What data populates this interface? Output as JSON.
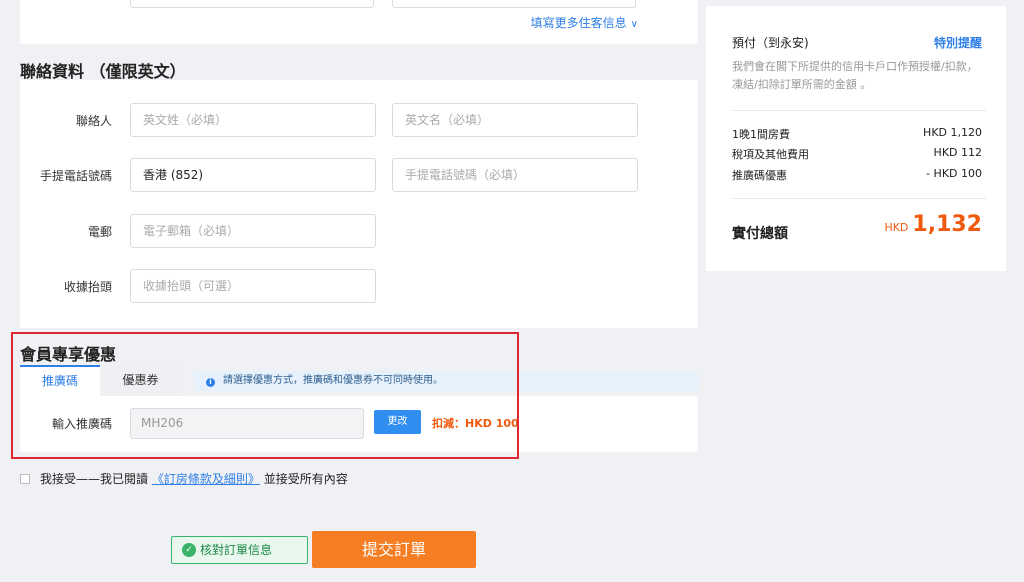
{
  "guest_section": {
    "more_link": "填寫更多住客信息",
    "chevron_icon": "chevron-down-icon"
  },
  "contact": {
    "title": "聯絡資料 （僅限英文）",
    "name_label": "聯絡人",
    "last_name_placeholder": "英文姓（必填）",
    "first_name_placeholder": "英文名（必填）",
    "phone_label": "手提電話號碼",
    "country_code_value": "香港 (852)",
    "phone_placeholder": "手提電話號碼（必填）",
    "email_label": "電郵",
    "email_placeholder": "電子郵箱（必填）",
    "receipt_label": "收據抬頭",
    "receipt_placeholder": "收據抬頭（可選）"
  },
  "promo": {
    "title": "會員專享優惠",
    "tabs": [
      {
        "label": "推廣碼",
        "active": true
      },
      {
        "label": "優惠券",
        "active": false
      }
    ],
    "notice": "請選擇優惠方式，推廣碼和優惠券不可同時使用。",
    "input_label": "輸入推廣碼",
    "input_value": "MH206",
    "change_button": "更改",
    "discount_text": "扣減：HKD 100"
  },
  "agreement": {
    "prefix": "我接受——我已閱讀",
    "link": "《訂房條款及細則》",
    "suffix": "並接受所有內容"
  },
  "actions": {
    "verify": "核對訂單信息",
    "submit": "提交訂單"
  },
  "summary": {
    "payment_type": "預付（到永安)",
    "reminder": "特別提醒",
    "description": "我們會在閣下所提供的信用卡戶口作預授權/扣款，凍結/扣除訂單所需的金額 。",
    "rows": [
      {
        "label": "1晚1間房費",
        "value": "HKD 1,120"
      },
      {
        "label": "稅項及其他費用",
        "value": "HKD 112"
      },
      {
        "label": "推廣碼優惠",
        "value": "- HKD 100"
      }
    ],
    "total_label": "實付總額",
    "total_currency": "HKD",
    "total_amount": "1,132"
  },
  "colors": {
    "accent_blue": "#2f7fe6",
    "price_orange": "#f05a0c",
    "submit_orange": "#f57d23",
    "highlight_red": "#e0262e",
    "verify_green": "#3cb36b"
  }
}
